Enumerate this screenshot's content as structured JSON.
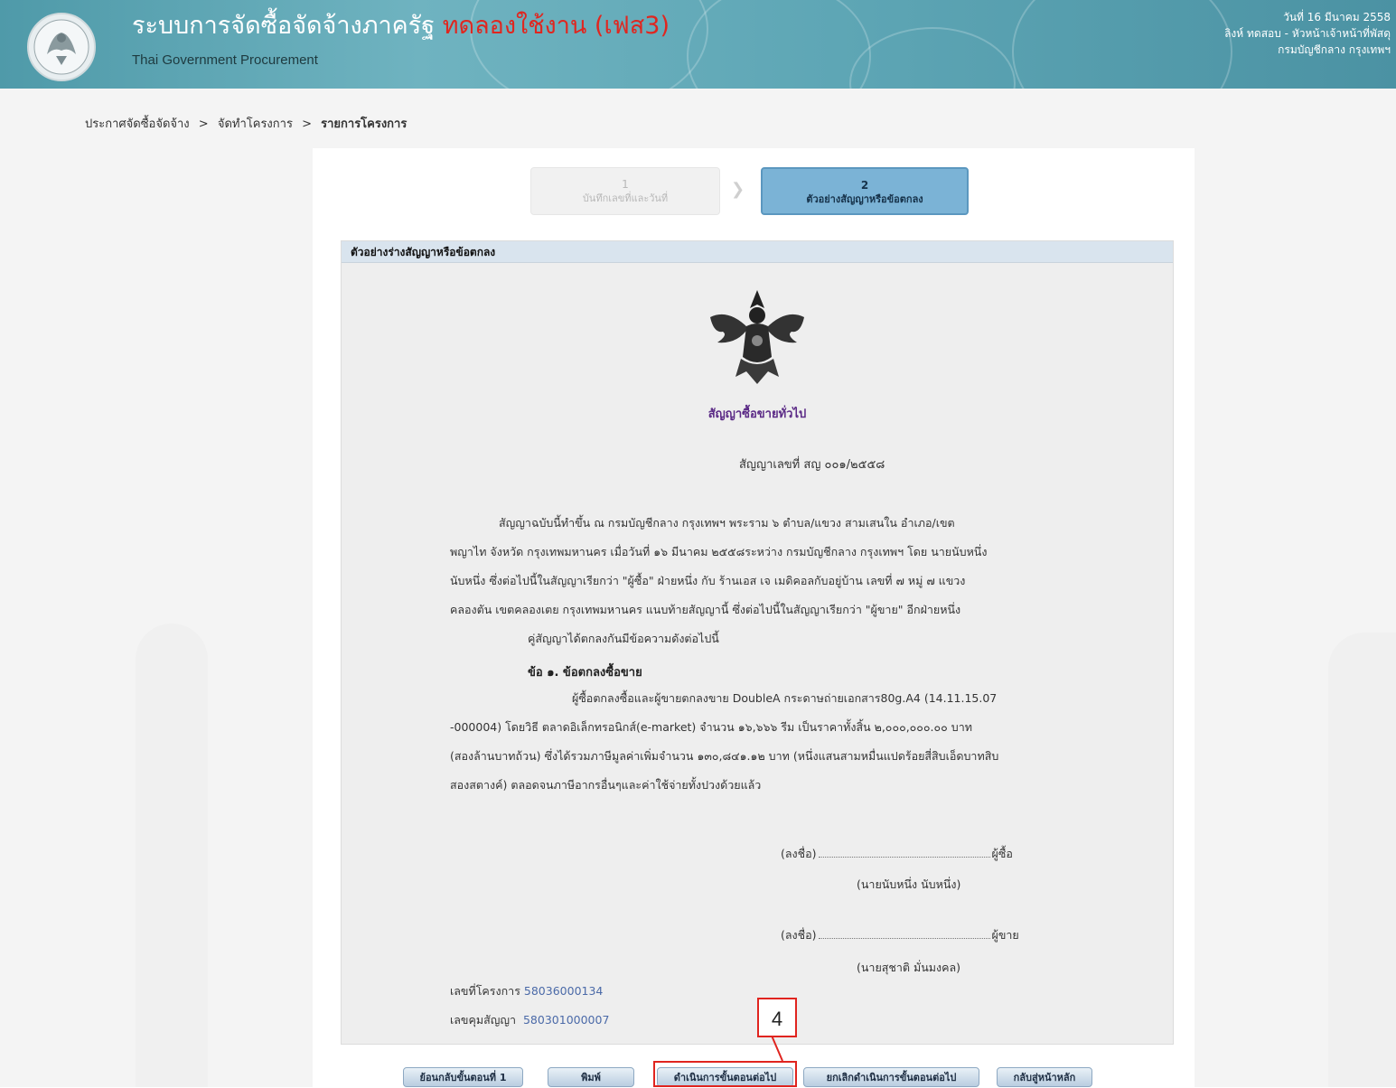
{
  "header": {
    "title_main": "ระบบการจัดซื้อจัดจ้างภาครัฐ",
    "title_trial": "ทดลองใช้งาน (เฟส3)",
    "subtitle": "Thai Government Procurement",
    "date": "วันที่ 16 มีนาคม 2558",
    "user": "ลิงห์ ทดสอบ - หัวหน้าเจ้าหน้าที่พัสดุ",
    "org": "กรมบัญชีกลาง กรุงเทพฯ"
  },
  "breadcrumb": {
    "item1": "ประกาศจัดซื้อจัดจ้าง",
    "item2": "จัดทำโครงการ",
    "item3": "รายการโครงการ",
    "separator": ">"
  },
  "steps": [
    {
      "number": "1",
      "label": "บันทึกเลขที่และวันที่"
    },
    {
      "number": "2",
      "label": "ตัวอย่างสัญญาหรือข้อตกลง"
    }
  ],
  "contract": {
    "section_title": "ตัวอย่างร่างสัญญาหรือข้อตกลง",
    "doc_title": "สัญญาซื้อขายทั่วไป",
    "doc_number": "สัญญาเลขที่ สญ ๐๐๑/๒๕๕๘",
    "para1_lines": [
      "สัญญาฉบับนี้ทำขึ้น ณ กรมบัญชีกลาง กรุงเทพฯ พระราม ๖ ตำบล/แขวง สามเสนใน อำเภอ/เขต",
      "พญาไท จังหวัด กรุงเทพมหานคร เมื่อวันที่ ๑๖ มีนาคม ๒๕๕๘ระหว่าง กรมบัญชีกลาง กรุงเทพฯ โดย นายนับหนึ่ง",
      "นับหนึ่ง ซึ่งต่อไปนี้ในสัญญาเรียกว่า \"ผู้ซื้อ\" ฝ่ายหนึ่ง กับ ร้านเอส เจ เมดิคอลกับอยู่บ้าน เลขที่ ๗ หมู่ ๗ แขวง",
      "คลองตัน เขตคลองเตย กรุงเทพมหานคร แนบท้ายสัญญานี้ ซึ่งต่อไปนี้ในสัญญาเรียกว่า \"ผู้ขาย\" อีกฝ่ายหนึ่ง",
      "คู่สัญญาได้ตกลงกันมีข้อความดังต่อไปนี้"
    ],
    "clause1_title": "ข้อ ๑. ข้อตกลงซื้อขาย",
    "clause1_lines": [
      "ผู้ซื้อตกลงซื้อและผู้ขายตกลงขาย DoubleA กระดาษถ่ายเอกสาร80g.A4 (14.11.15.07",
      "-000004) โดยวิธี ตลาดอิเล็กทรอนิกส์(e-market) จำนวน ๑๖,๖๖๖ รีม เป็นราคาทั้งสิ้น ๒,๐๐๐,๐๐๐.๐๐ บาท",
      "(สองล้านบาทถ้วน) ซึ่งได้รวมภาษีมูลค่าเพิ่มจำนวน ๑๓๐,๘๔๑.๑๒ บาท (หนึ่งแสนสามหมื่นแปดร้อยสี่สิบเอ็ดบาทสิบ",
      "สองสตางค์) ตลอดจนภาษีอากรอื่นๆและค่าใช้จ่ายทั้งปวงด้วยแล้ว"
    ],
    "sign_prefix": "(ลงชื่อ)",
    "buyer_role": "ผู้ซื้อ",
    "buyer_name": "(นายนับหนึ่ง นับหนึ่ง)",
    "seller_role": "ผู้ขาย",
    "seller_name": "(นายสุชาติ มั่นมงคล)",
    "project_label": "เลขที่โครงการ",
    "project_no": "58036000134",
    "control_label": "เลขคุมสัญญา",
    "control_no": "580301000007"
  },
  "buttons": {
    "back_step1": "ย้อนกลับขั้นตอนที่ 1",
    "print": "พิมพ์",
    "next": "ดำเนินการขั้นตอนต่อไป",
    "cancel_next": "ยกเลิกดำเนินการขั้นตอนต่อไป",
    "home": "กลับสู่หน้าหลัก"
  },
  "callout": {
    "number": "4"
  },
  "colors": {
    "header": "#5ea6b5",
    "trial_red": "#e0261f",
    "step_active": "#7bb3d6",
    "callout_red": "#e0241f"
  }
}
